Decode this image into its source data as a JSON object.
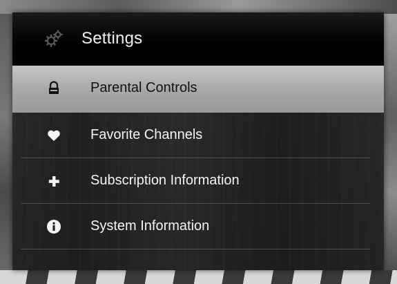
{
  "header": {
    "title": "Settings",
    "icon": "gears-icon"
  },
  "menu": {
    "items": [
      {
        "label": "Parental Controls",
        "icon": "lock-icon",
        "selected": true
      },
      {
        "label": "Favorite Channels",
        "icon": "heart-icon",
        "selected": false
      },
      {
        "label": "Subscription Information",
        "icon": "plus-icon",
        "selected": false
      },
      {
        "label": "System Information",
        "icon": "info-icon",
        "selected": false
      }
    ]
  },
  "colors": {
    "selected_background": "#b4b4b4",
    "panel_background": "#181818",
    "header_background": "#000000",
    "text": "#f4f4f4"
  }
}
